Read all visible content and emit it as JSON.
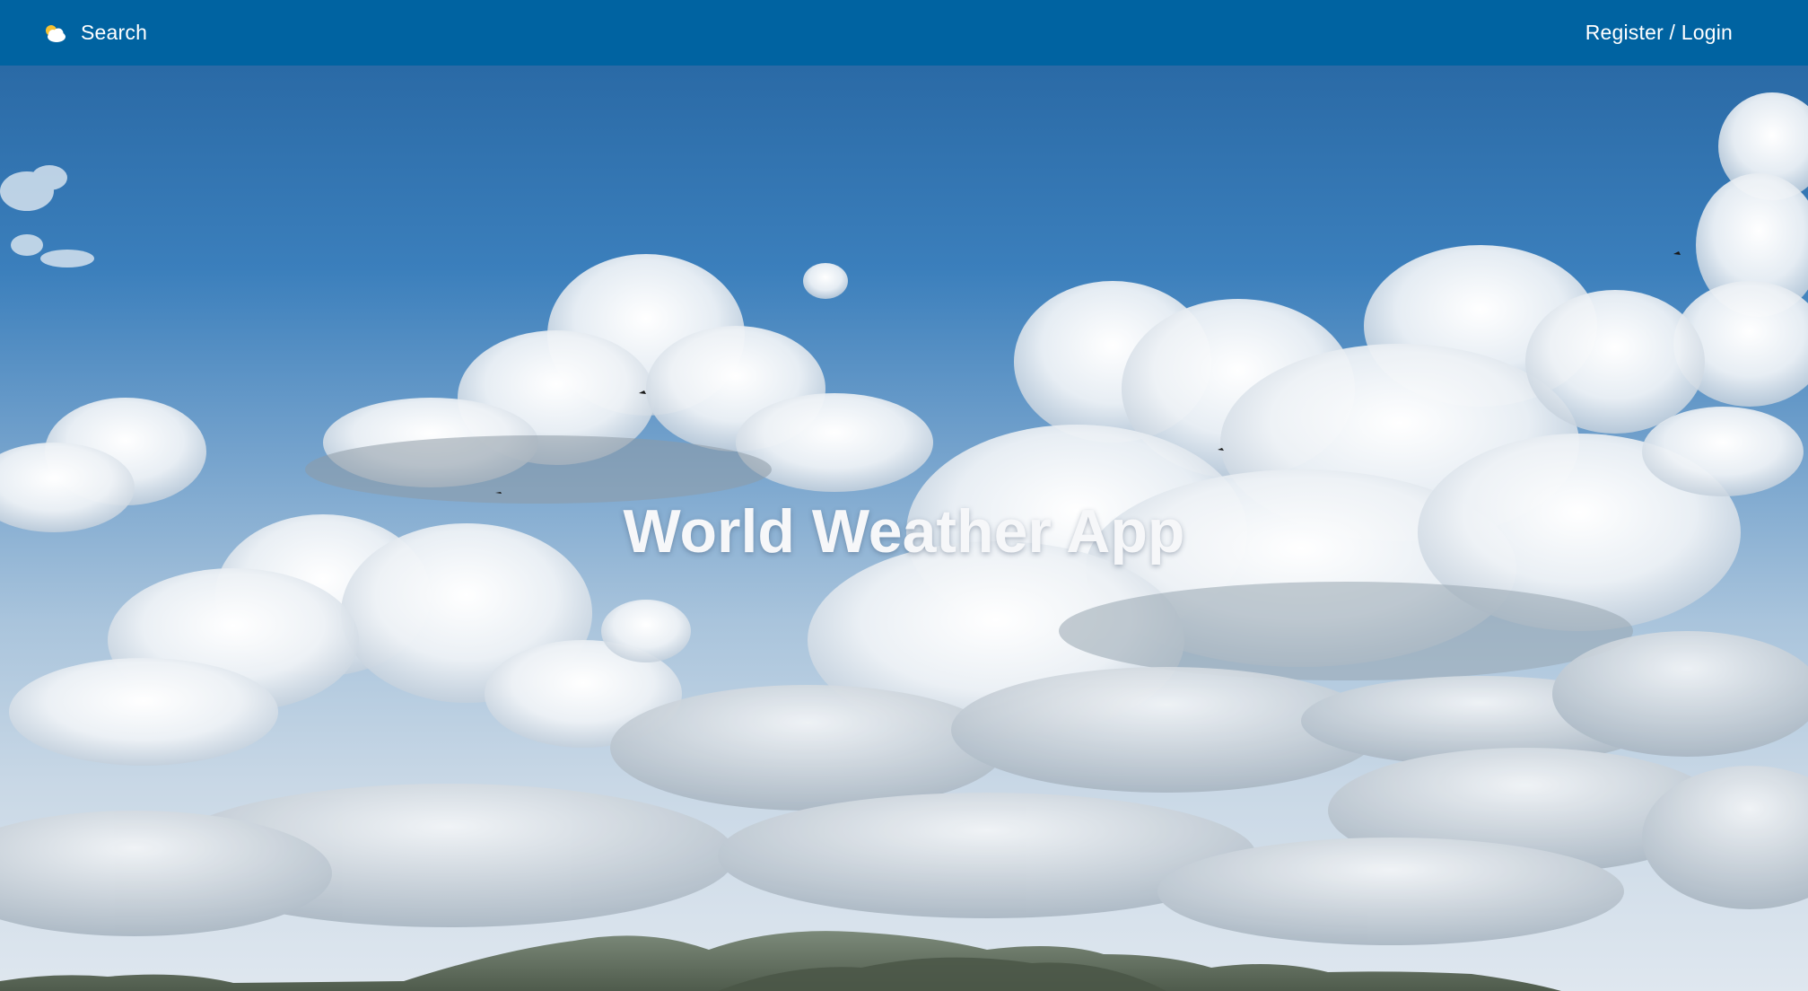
{
  "navbar": {
    "brand_icon": "sun-cloud-icon",
    "search_label": "Search",
    "auth_label": "Register / Login",
    "background_color": "#0063a1"
  },
  "hero": {
    "title": "World Weather App",
    "background": "cloudy-sky-over-hills-photo"
  }
}
